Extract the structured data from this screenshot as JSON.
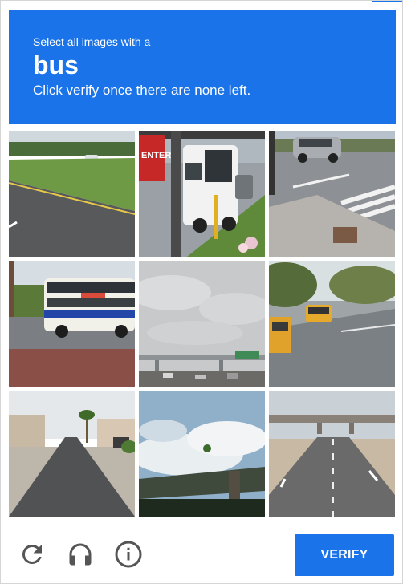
{
  "header": {
    "instruction": "Select all images with a",
    "target": "bus",
    "subtext": "Click verify once there are none left."
  },
  "tiles": [
    {
      "content": "highway-with-grass",
      "selected": false
    },
    {
      "content": "white-shuttle-bus-with-enter-sign",
      "selected": false
    },
    {
      "content": "crosswalk-with-suv",
      "selected": false
    },
    {
      "content": "double-decker-bus",
      "selected": false
    },
    {
      "content": "cloudy-sky-overpass",
      "selected": false
    },
    {
      "content": "yellow-school-buses-street",
      "selected": false
    },
    {
      "content": "residential-road-palm-tree",
      "selected": false
    },
    {
      "content": "sky-with-bridge",
      "selected": false
    },
    {
      "content": "highway-overpass",
      "selected": false
    }
  ],
  "tile_text": {
    "enter_sign": "ENTER"
  },
  "footer": {
    "reload_icon": "reload-icon",
    "audio_icon": "headphones-icon",
    "info_icon": "info-icon",
    "verify_label": "VERIFY"
  },
  "colors": {
    "accent": "#1a73e8",
    "icon_gray": "#555555"
  }
}
